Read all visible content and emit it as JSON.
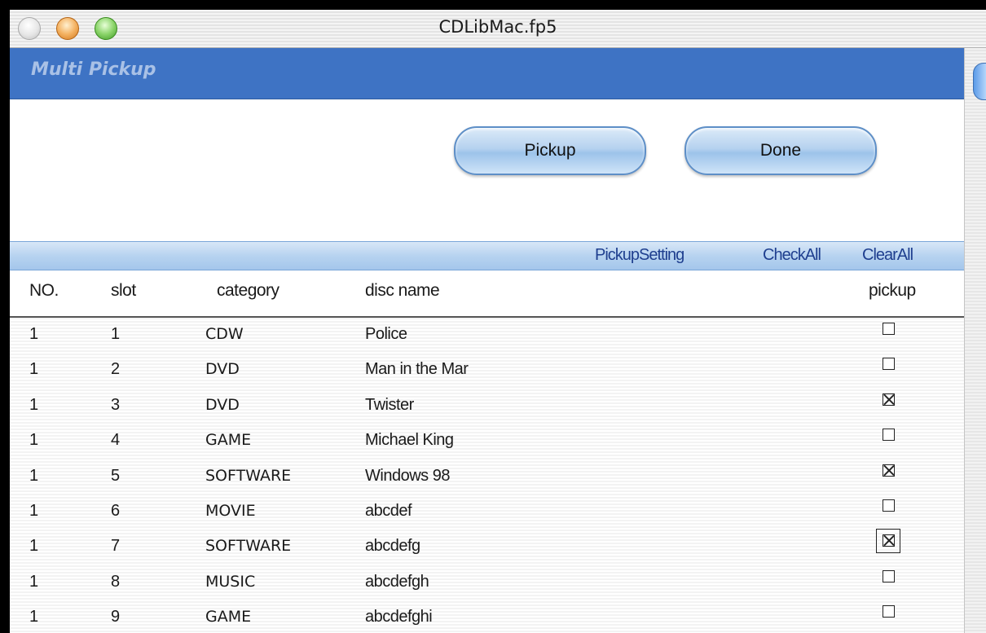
{
  "window": {
    "title": "CDLibMac.fp5"
  },
  "header": {
    "title": "Multi Pickup"
  },
  "buttons": {
    "pickup": "Pickup",
    "done": "Done"
  },
  "toolbar": {
    "pickup_setting": "PickupSetting",
    "check_all": "CheckAll",
    "clear_all": "ClearAll"
  },
  "columns": {
    "no": "NO.",
    "slot": "slot",
    "category": "category",
    "disc_name": "disc name",
    "pickup": "pickup"
  },
  "rows": [
    {
      "no": "1",
      "slot": "1",
      "category": "CDW",
      "disc_name": "Police",
      "pickup": false
    },
    {
      "no": "1",
      "slot": "2",
      "category": "DVD",
      "disc_name": "Man in the Mar",
      "pickup": false
    },
    {
      "no": "1",
      "slot": "3",
      "category": "DVD",
      "disc_name": "Twister",
      "pickup": true
    },
    {
      "no": "1",
      "slot": "4",
      "category": "GAME",
      "disc_name": "Michael King",
      "pickup": false
    },
    {
      "no": "1",
      "slot": "5",
      "category": "SOFTWARE",
      "disc_name": "Windows 98",
      "pickup": true
    },
    {
      "no": "1",
      "slot": "6",
      "category": "MOVIE",
      "disc_name": "abcdef",
      "pickup": false
    },
    {
      "no": "1",
      "slot": "7",
      "category": "SOFTWARE",
      "disc_name": "abcdefg",
      "pickup": true,
      "focused": true
    },
    {
      "no": "1",
      "slot": "8",
      "category": "MUSIC",
      "disc_name": "abcdefgh",
      "pickup": false
    },
    {
      "no": "1",
      "slot": "9",
      "category": "GAME",
      "disc_name": "abcdefghi",
      "pickup": false
    }
  ],
  "colors": {
    "header_band": "#3e73c4",
    "header_title": "#a9c1e6",
    "toolbar_link": "#1f3f8f"
  }
}
